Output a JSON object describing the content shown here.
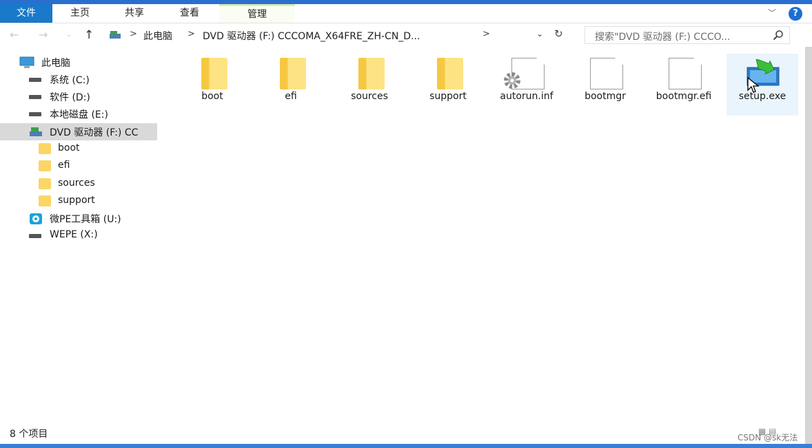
{
  "ribbon": {
    "tabs": [
      {
        "label": "文件"
      },
      {
        "label": "主页"
      },
      {
        "label": "共享"
      },
      {
        "label": "查看"
      },
      {
        "label": "管理"
      }
    ],
    "help_label": "?",
    "collapse_label": "﹀"
  },
  "nav": {
    "back": "←",
    "forward": "→",
    "recent": "⌄",
    "up": "↑",
    "breadcrumb": [
      {
        "label": "此电脑"
      },
      {
        "label": "DVD 驱动器 (F:) CCCOMA_X64FRE_ZH-CN_D..."
      }
    ],
    "separator": ">",
    "refresh": "↻",
    "dropdown": "⌄"
  },
  "search": {
    "placeholder": "搜索\"DVD 驱动器 (F:) CCCO..."
  },
  "sidebar": {
    "items": [
      {
        "label": "此电脑",
        "icon": "computer-icon"
      },
      {
        "label": "系统 (C:)",
        "icon": "drive-icon"
      },
      {
        "label": "软件 (D:)",
        "icon": "drive-icon"
      },
      {
        "label": "本地磁盘 (E:)",
        "icon": "drive-icon"
      },
      {
        "label": "DVD 驱动器 (F:) CC",
        "icon": "dvd-drive-icon"
      },
      {
        "label": "boot",
        "icon": "folder-icon"
      },
      {
        "label": "efi",
        "icon": "folder-icon"
      },
      {
        "label": "sources",
        "icon": "folder-icon"
      },
      {
        "label": "support",
        "icon": "folder-icon"
      },
      {
        "label": "微PE工具箱 (U:)",
        "icon": "disc-icon"
      },
      {
        "label": "WEPE (X:)",
        "icon": "drive-icon"
      }
    ]
  },
  "files": [
    {
      "name": "boot",
      "type": "folder"
    },
    {
      "name": "efi",
      "type": "folder"
    },
    {
      "name": "sources",
      "type": "folder"
    },
    {
      "name": "support",
      "type": "folder"
    },
    {
      "name": "autorun.inf",
      "type": "settings-file"
    },
    {
      "name": "bootmgr",
      "type": "file"
    },
    {
      "name": "bootmgr.efi",
      "type": "file"
    },
    {
      "name": "setup.exe",
      "type": "installer"
    }
  ],
  "status": {
    "item_count": "8 个项目"
  },
  "watermark": "CSDN @sk无法",
  "colors": {
    "file_tab": "#1979ca",
    "folder": "#fbd666",
    "selection": "#d9d9d9",
    "accent": "#2a6fcf"
  }
}
